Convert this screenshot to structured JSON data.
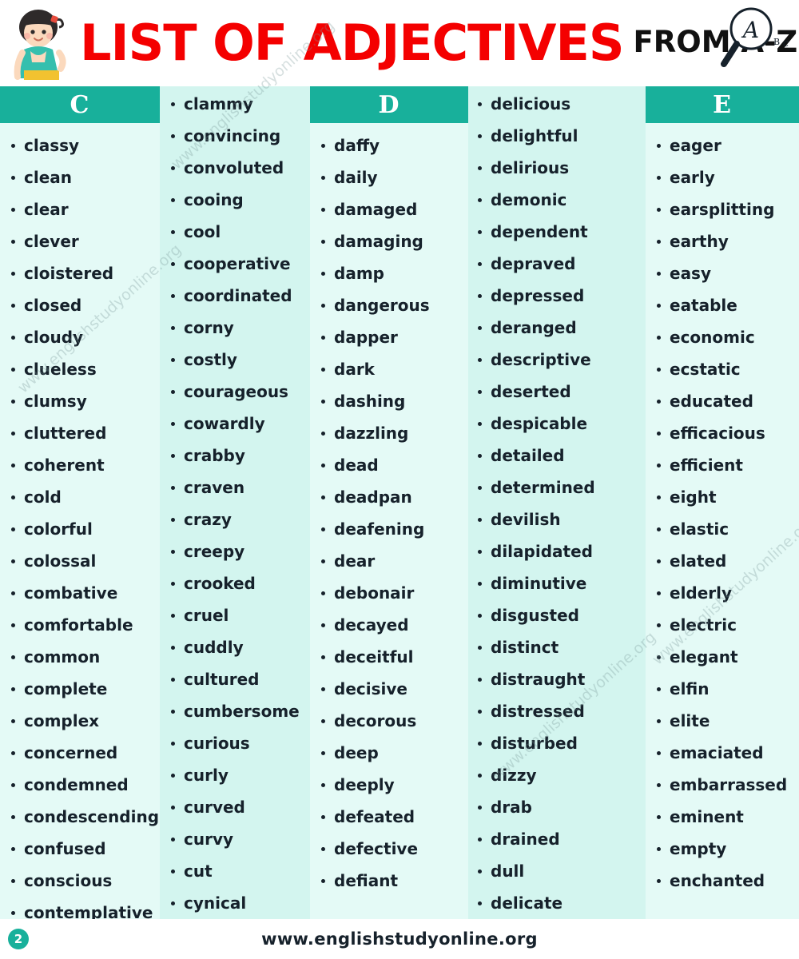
{
  "header": {
    "title_main": "LIST OF ADJECTIVES",
    "title_sub": "FROM A-Z",
    "title_color": "#f40000",
    "sub_color": "#111111",
    "mascot_icon": "girl-thinking-icon",
    "magnifier_icon": "magnifier-letter-a-icon",
    "magnifier_letter": "A",
    "magnifier_small_letters": "B C"
  },
  "theme": {
    "band_color": "#18b09b",
    "column_light": "#e4faf6",
    "column_dark": "#d3f5ef",
    "text_color": "#16212b"
  },
  "columns": [
    {
      "letter": "C",
      "show_letter": true,
      "words": [
        "classy",
        "clean",
        "clear",
        "clever",
        "cloistered",
        "closed",
        "cloudy",
        "clueless",
        "clumsy",
        "cluttered",
        "coherent",
        "cold",
        "colorful",
        "colossal",
        "combative",
        "comfortable",
        "common",
        "complete",
        "complex",
        "concerned",
        "condemned",
        "condescending",
        "confused",
        "conscious",
        "contemplative"
      ]
    },
    {
      "letter": "",
      "show_letter": false,
      "words": [
        "clammy",
        "convincing",
        "convoluted",
        "cooing",
        "cool",
        "cooperative",
        "coordinated",
        "corny",
        "costly",
        "courageous",
        "cowardly",
        "crabby",
        "craven",
        "crazy",
        "creepy",
        "crooked",
        "cruel",
        "cuddly",
        "cultured",
        "cumbersome",
        "curious",
        "curly",
        "curved",
        "curvy",
        "cut",
        "cynical"
      ]
    },
    {
      "letter": "D",
      "show_letter": true,
      "words": [
        "daffy",
        "daily",
        "damaged",
        "damaging",
        "damp",
        "dangerous",
        "dapper",
        "dark",
        "dashing",
        "dazzling",
        "dead",
        "deadpan",
        "deafening",
        "dear",
        "debonair",
        "decayed",
        "deceitful",
        "decisive",
        "decorous",
        "deep",
        "deeply",
        "defeated",
        "defective",
        "defiant"
      ]
    },
    {
      "letter": "",
      "show_letter": false,
      "words": [
        "delicious",
        "delightful",
        "delirious",
        "demonic",
        "dependent",
        "depraved",
        "depressed",
        "deranged",
        "descriptive",
        "deserted",
        "despicable",
        "detailed",
        "determined",
        "devilish",
        "dilapidated",
        "diminutive",
        "disgusted",
        "distinct",
        "distraught",
        "distressed",
        "disturbed",
        "dizzy",
        "drab",
        "drained",
        "dull",
        "delicate"
      ]
    },
    {
      "letter": "E",
      "show_letter": true,
      "words": [
        "eager",
        "early",
        "earsplitting",
        "earthy",
        "easy",
        "eatable",
        "economic",
        "ecstatic",
        "educated",
        "efficacious",
        "efficient",
        "eight",
        "elastic",
        "elated",
        "elderly",
        "electric",
        "elegant",
        "elfin",
        "elite",
        "emaciated",
        "embarrassed",
        "eminent",
        "empty",
        "enchanted"
      ]
    }
  ],
  "watermarks": [
    "www.englishstudyonline.org",
    "www.englishstudyonline.org",
    "www.englishstudyonline.org",
    "www.englishstudyonline.org"
  ],
  "footer": {
    "url": "www.englishstudyonline.org",
    "page_number": "2"
  }
}
